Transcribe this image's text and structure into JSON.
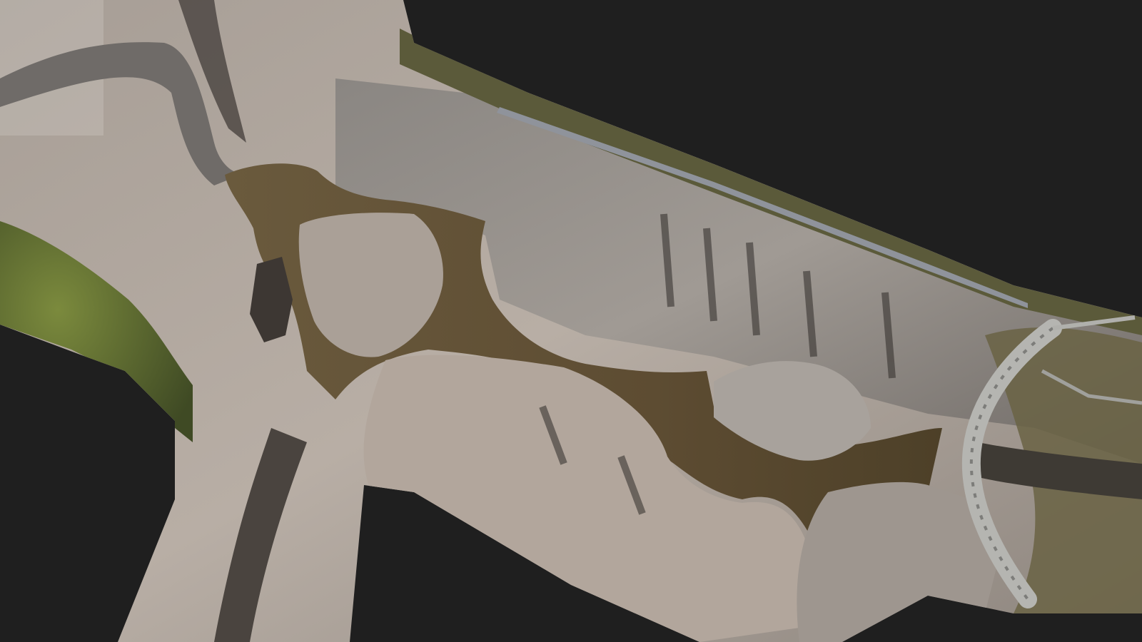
{
  "viewer": {
    "background_color": "#1f1f1f",
    "content": "orthomosaic"
  },
  "orthomosaic": {
    "palette": {
      "rock_light": "#b7ada4",
      "rock_mid": "#9b918a",
      "rock_dark": "#5e5853",
      "shadow": "#2f2b28",
      "water": "#5e4e33",
      "water_dark": "#3a3122",
      "vegetation": "#4e5a2c",
      "vegetation_light": "#7f8a43",
      "concrete": "#a8a8a4",
      "road": "#8f939b"
    }
  }
}
